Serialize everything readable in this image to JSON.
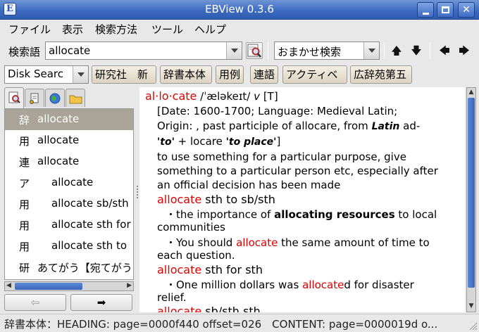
{
  "window": {
    "title": "EBView 0.3.6",
    "app_icon_letter": "E"
  },
  "menu": [
    "ファイル",
    "表示",
    "検索方法",
    "ツール",
    "ヘルプ"
  ],
  "search": {
    "label": "検索語",
    "query": "allocate",
    "method": "おまかせ検索",
    "up_arrow": "🡅",
    "down_arrow": "🡇",
    "back_arrow": "🡄",
    "forward_arrow": "🡆"
  },
  "dict_bar": {
    "group": "Disk Searc",
    "buttons": [
      "研究社　新",
      "辞書本体",
      "用例",
      "連語",
      "アクティベ",
      "広辞苑第五"
    ]
  },
  "result_list": [
    {
      "kind": "辞",
      "word": "allocate",
      "selected": true
    },
    {
      "kind": "用",
      "word": "allocate",
      "selected": false
    },
    {
      "kind": "連",
      "word": "allocate",
      "selected": false
    },
    {
      "kind": "ア",
      "word": "allocate",
      "selected": false
    },
    {
      "kind": "用",
      "word": "allocate sb/sth",
      "selected": false
    },
    {
      "kind": "用",
      "word": "allocate sth for",
      "selected": false
    },
    {
      "kind": "用",
      "word": "allocate sth to",
      "selected": false
    },
    {
      "kind": "研",
      "word": "あてがう【宛てがう",
      "selected": false
    }
  ],
  "nav": {
    "prev": "⇦",
    "next": "➡"
  },
  "entry": {
    "headword": "al·lo·cate",
    "pron": "/ˈæləkeɪt/",
    "pos": "v",
    "grammar": "[T]",
    "etym1": "[Date: 1600-1700; Language: Medieval Latin;",
    "etym2a": "Origin: , past participle of  allocare, from ",
    "etym2b": "Latin",
    "etym2c": " ad-",
    "etym3a": "'to'",
    "etym3b": " + locare ",
    "etym3c": "'to place'",
    "etym3d": "]",
    "def1": "to use something for a particular purpose, give",
    "def2": "something to a particular person etc, especially after",
    "def3": "an official decision has been made",
    "p1a": "allocate",
    "p1b": " sth to sb/sth",
    "ex1a": "・the importance of ",
    "ex1b": "allocating resources",
    "ex1c": " to local",
    "ex1d": "communities",
    "ex2a": "・You should ",
    "ex2b": "allocate",
    "ex2c": " the same amount of time to",
    "ex2d": "each question.",
    "p2a": "allocate",
    "p2b": " sth for sth",
    "ex3a": "・One million dollars was ",
    "ex3b": "allocate",
    "ex3c": "d for disaster",
    "ex3d": "relief.",
    "p3a": "allocate",
    "p3b": " sb/sth sth"
  },
  "status": "辞書本体：HEADING: page=0000f440 offset=026　CONTENT: page=0000019d o..."
}
